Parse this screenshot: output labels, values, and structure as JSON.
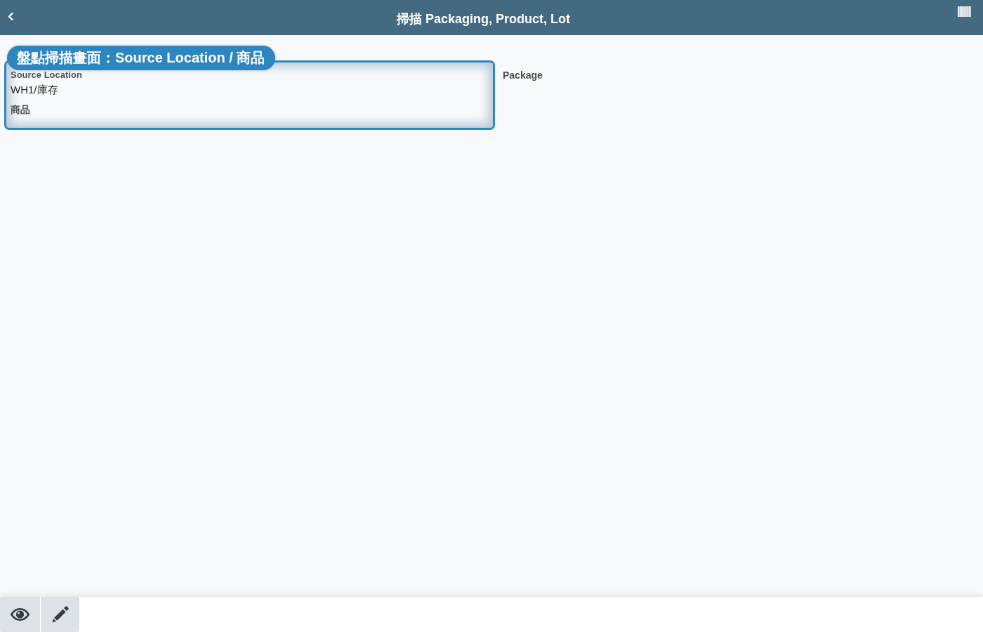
{
  "header": {
    "title": "掃描 Packaging, Product, Lot"
  },
  "annotation": {
    "callout": "盤點掃描畫面：Source Location / 商品"
  },
  "form": {
    "left_fields": [
      {
        "label": "Source Location",
        "value": "WH1/庫存"
      },
      {
        "label": "商品"
      }
    ],
    "right_fields": [
      {
        "label": "Package"
      }
    ]
  },
  "toolbar": {
    "buttons": [
      {
        "kind": "view"
      },
      {
        "kind": "edit"
      }
    ]
  }
}
